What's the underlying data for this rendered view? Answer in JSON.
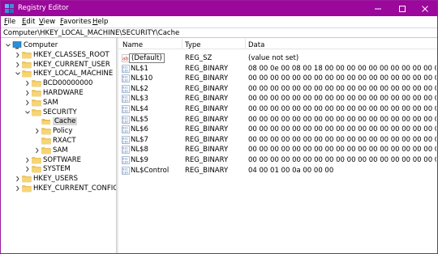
{
  "window": {
    "title": "Registry Editor",
    "accent": "#9b089b"
  },
  "menu": [
    "File",
    "Edit",
    "View",
    "Favorites",
    "Help"
  ],
  "address": "Computer\\HKEY_LOCAL_MACHINE\\SECURITY\\Cache",
  "tree": {
    "items": [
      {
        "label": "Computer",
        "icon": "computer-icon",
        "chev": "down"
      },
      {
        "label": "HKEY_CLASSES_ROOT",
        "icon": "folder-icon",
        "chev": "right"
      },
      {
        "label": "HKEY_CURRENT_USER",
        "icon": "folder-icon",
        "chev": "right"
      },
      {
        "label": "HKEY_LOCAL_MACHINE",
        "icon": "folder-icon",
        "chev": "down"
      },
      {
        "label": "BCD00000000",
        "icon": "folder-icon",
        "chev": "right"
      },
      {
        "label": "HARDWARE",
        "icon": "folder-icon",
        "chev": "right"
      },
      {
        "label": "SAM",
        "icon": "folder-icon",
        "chev": "right"
      },
      {
        "label": "SECURITY",
        "icon": "folder-icon",
        "chev": "down"
      },
      {
        "label": "Cache",
        "icon": "folder-open-icon",
        "chev": "none",
        "selected": true
      },
      {
        "label": "Policy",
        "icon": "folder-icon",
        "chev": "right"
      },
      {
        "label": "RXACT",
        "icon": "folder-icon",
        "chev": "none"
      },
      {
        "label": "SAM",
        "icon": "folder-icon",
        "chev": "right"
      },
      {
        "label": "SOFTWARE",
        "icon": "folder-icon",
        "chev": "right"
      },
      {
        "label": "SYSTEM",
        "icon": "folder-icon",
        "chev": "right"
      },
      {
        "label": "HKEY_USERS",
        "icon": "folder-icon",
        "chev": "right"
      },
      {
        "label": "HKEY_CURRENT_CONFIG",
        "icon": "folder-icon",
        "chev": "right"
      }
    ]
  },
  "list": {
    "columns": [
      "Name",
      "Type",
      "Data"
    ],
    "rows": [
      {
        "name": "(Default)",
        "type": "REG_SZ",
        "data": "(value not set)",
        "icon": "string-value-icon"
      },
      {
        "name": "NL$1",
        "type": "REG_BINARY",
        "data": "08 00 0e 00 08 00 18 00 00 00 00 00 00 00 00 00 00 00 00",
        "icon": "binary-value-icon"
      },
      {
        "name": "NL$10",
        "type": "REG_BINARY",
        "data": "00 00 00 00 00 00 00 00 00 00 00 00 00 00 00 00 00 00 00",
        "icon": "binary-value-icon"
      },
      {
        "name": "NL$2",
        "type": "REG_BINARY",
        "data": "00 00 00 00 00 00 00 00 00 00 00 00 00 00 00 00 00 00 00",
        "icon": "binary-value-icon"
      },
      {
        "name": "NL$3",
        "type": "REG_BINARY",
        "data": "00 00 00 00 00 00 00 00 00 00 00 00 00 00 00 00 00 00 00",
        "icon": "binary-value-icon"
      },
      {
        "name": "NL$4",
        "type": "REG_BINARY",
        "data": "00 00 00 00 00 00 00 00 00 00 00 00 00 00 00 00 00 00 00",
        "icon": "binary-value-icon"
      },
      {
        "name": "NL$5",
        "type": "REG_BINARY",
        "data": "00 00 00 00 00 00 00 00 00 00 00 00 00 00 00 00 00 00 00",
        "icon": "binary-value-icon"
      },
      {
        "name": "NL$6",
        "type": "REG_BINARY",
        "data": "00 00 00 00 00 00 00 00 00 00 00 00 00 00 00 00 00 00 00",
        "icon": "binary-value-icon"
      },
      {
        "name": "NL$7",
        "type": "REG_BINARY",
        "data": "00 00 00 00 00 00 00 00 00 00 00 00 00 00 00 00 00 00 00",
        "icon": "binary-value-icon"
      },
      {
        "name": "NL$8",
        "type": "REG_BINARY",
        "data": "00 00 00 00 00 00 00 00 00 00 00 00 00 00 00 00 00 00 00",
        "icon": "binary-value-icon"
      },
      {
        "name": "NL$9",
        "type": "REG_BINARY",
        "data": "00 00 00 00 00 00 00 00 00 00 00 00 00 00 00 00 00 00 00",
        "icon": "binary-value-icon"
      },
      {
        "name": "NL$Control",
        "type": "REG_BINARY",
        "data": "04 00 01 00 0a 00 00 00",
        "icon": "binary-value-icon"
      }
    ]
  }
}
